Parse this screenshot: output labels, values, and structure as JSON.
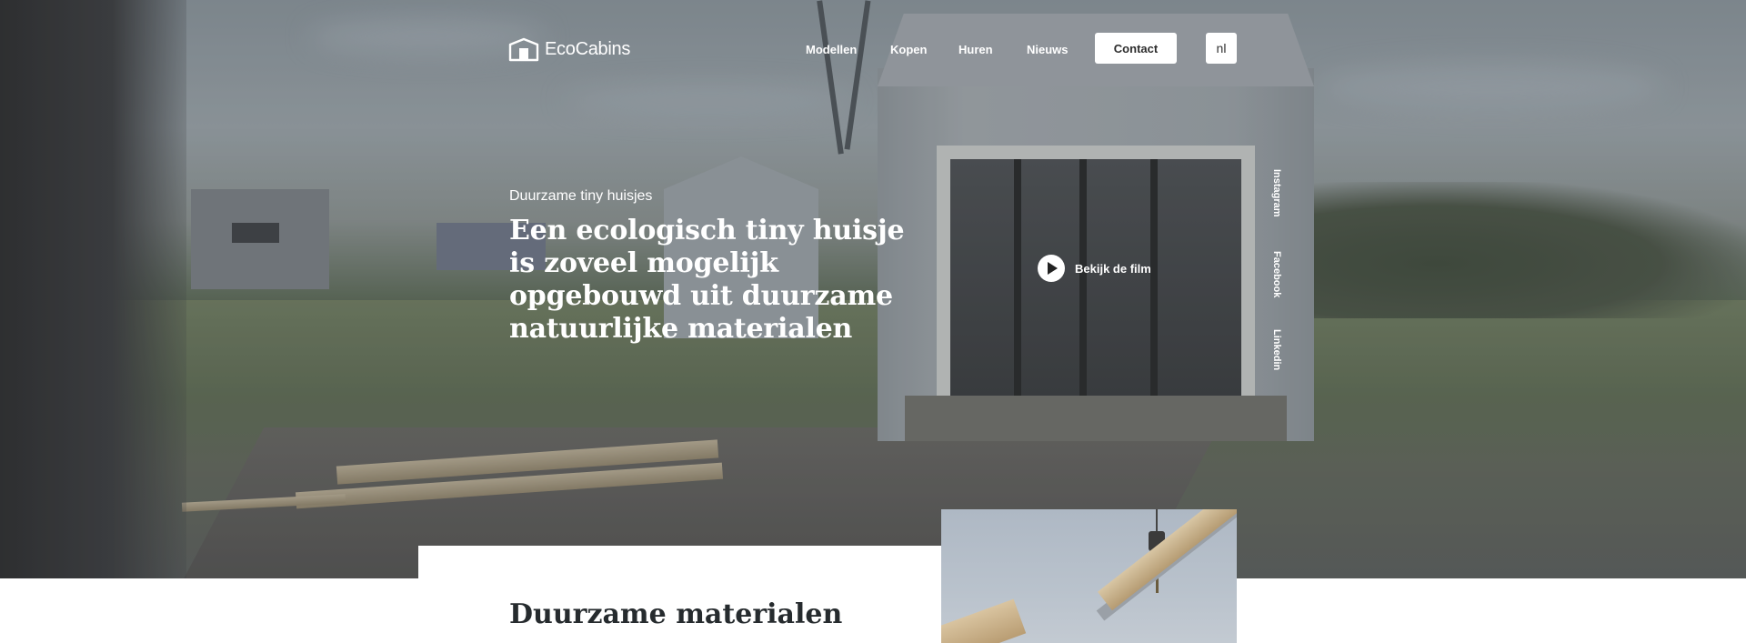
{
  "header": {
    "logo_text": "EcoCabins",
    "nav": [
      "Modellen",
      "Kopen",
      "Huren",
      "Nieuws"
    ],
    "contact_label": "Contact",
    "language": "nl"
  },
  "hero": {
    "eyebrow": "Duurzame tiny huisjes",
    "headline": "Een ecologisch tiny huisje is zoveel mogelijk opgebouwd uit duurzame natuurlijke materialen",
    "play_label": "Bekijk de film",
    "social": [
      "Instagram",
      "Facebook",
      "Linkedin"
    ]
  },
  "content": {
    "section_title": "Duurzame materialen"
  }
}
